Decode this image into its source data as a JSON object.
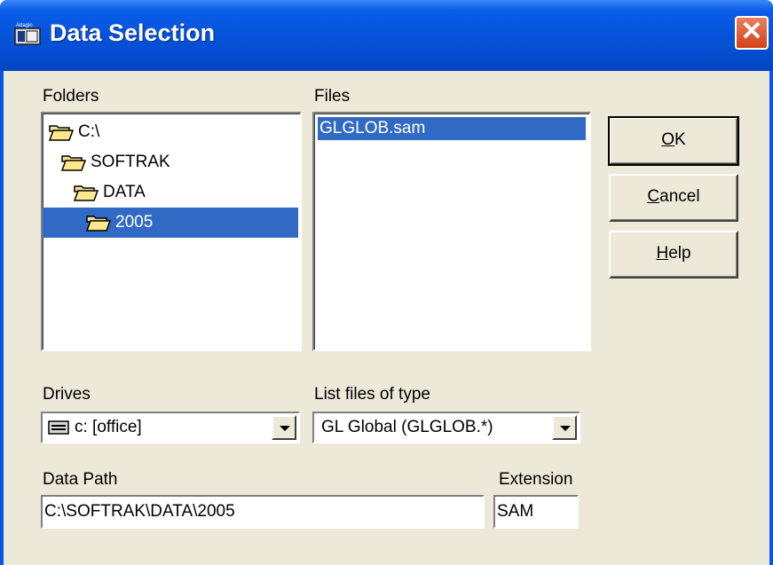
{
  "window": {
    "title": "Data Selection",
    "close_symbol": "✕"
  },
  "folders": {
    "label": "Folders",
    "items": [
      {
        "name": "C:\\",
        "icon": "open-folder-icon",
        "indent": 0,
        "selected": false
      },
      {
        "name": "SOFTRAK",
        "icon": "open-folder-icon",
        "indent": 1,
        "selected": false
      },
      {
        "name": "DATA",
        "icon": "open-folder-icon",
        "indent": 2,
        "selected": false
      },
      {
        "name": "2005",
        "icon": "open-folder-icon",
        "indent": 3,
        "selected": true
      }
    ]
  },
  "files": {
    "label": "Files",
    "items": [
      {
        "name": "GLGLOB.sam",
        "selected": true
      }
    ]
  },
  "buttons": {
    "ok": {
      "mnemonic": "O",
      "rest": "K"
    },
    "cancel": {
      "mnemonic": "C",
      "rest": "ancel"
    },
    "help": {
      "mnemonic": "H",
      "rest": "elp"
    }
  },
  "drives": {
    "label": "Drives",
    "value": "c: [office]",
    "icon": "drive-icon"
  },
  "file_type": {
    "label": "List files of type",
    "value": "GL Global (GLGLOB.*)"
  },
  "data_path": {
    "label": "Data Path",
    "value": "C:\\SOFTRAK\\DATA\\2005"
  },
  "extension": {
    "label": "Extension",
    "value": "SAM"
  },
  "colors": {
    "selection": "#316ac5",
    "titlebar": "#0552d8",
    "face": "#ece9d8"
  }
}
